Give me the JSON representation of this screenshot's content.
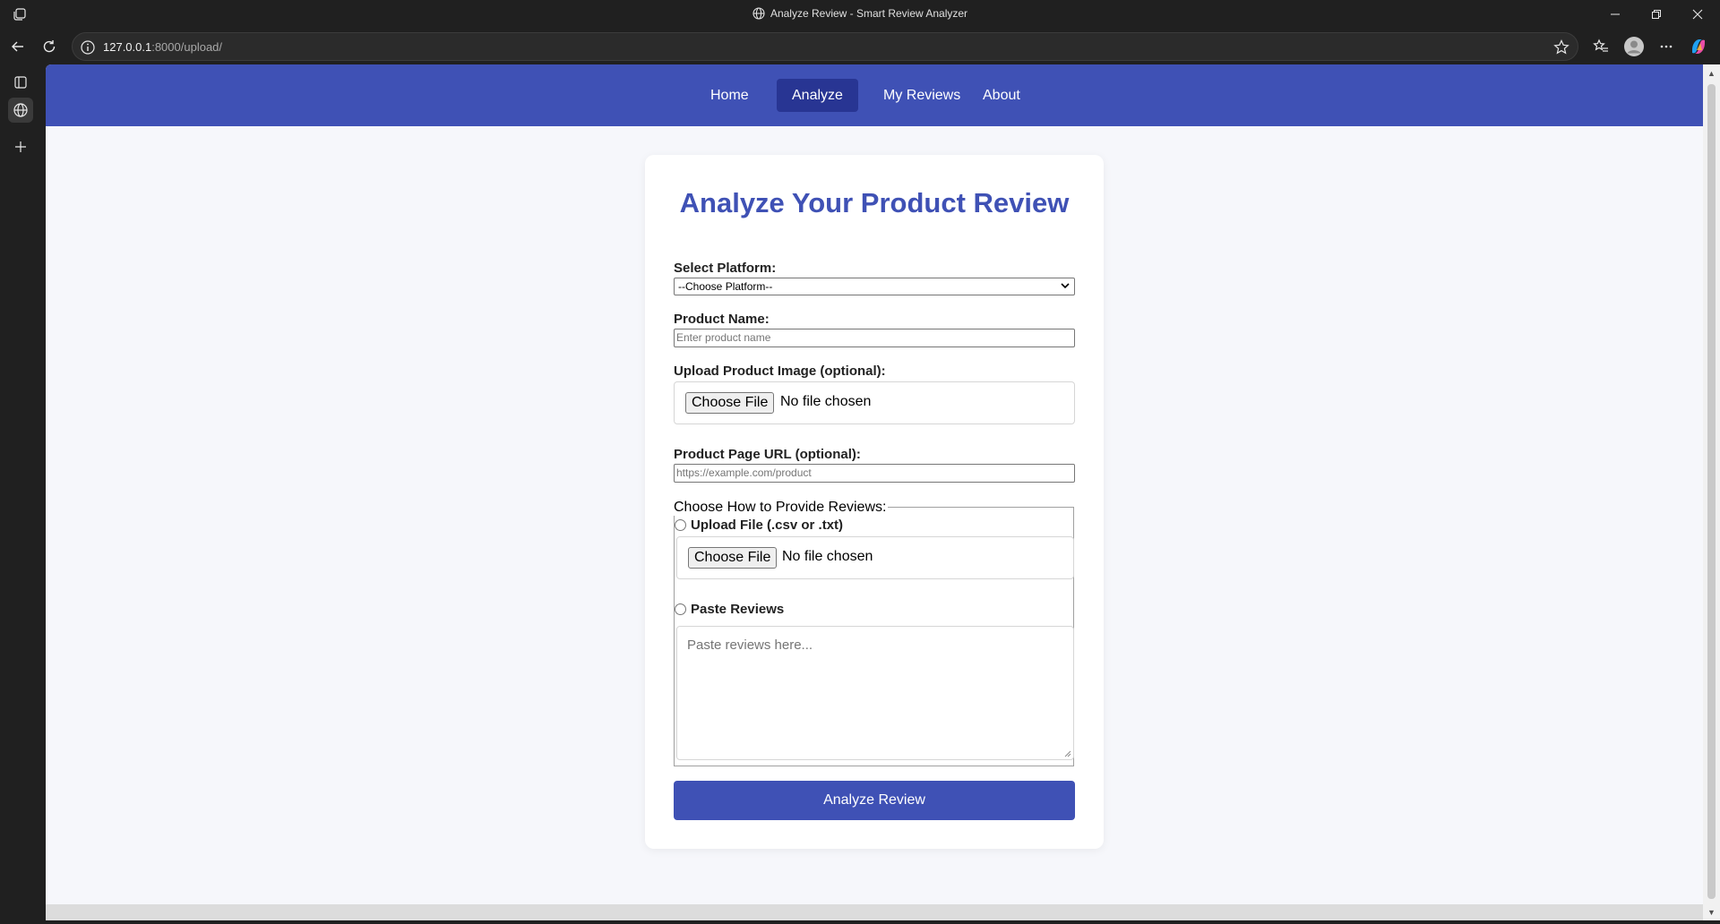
{
  "browser": {
    "tab_title": "Analyze Review - Smart Review Analyzer",
    "url_host": "127.0.0.1",
    "url_rest": ":8000/upload/"
  },
  "nav": {
    "items": [
      "Home",
      "Analyze",
      "My Reviews",
      "About"
    ],
    "active": "Analyze"
  },
  "form": {
    "title": "Analyze Your Product Review",
    "platform_label": "Select Platform:",
    "platform_selected": "--Choose Platform--",
    "product_name_label": "Product Name:",
    "product_name_placeholder": "Enter product name",
    "image_label": "Upload Product Image (optional):",
    "choose_file": "Choose File",
    "no_file": "No file chosen",
    "url_label": "Product Page URL (optional):",
    "url_placeholder": "https://example.com/product",
    "reviews_legend": "Choose How to Provide Reviews:",
    "option_upload": "Upload File (.csv or .txt)",
    "option_paste": "Paste Reviews",
    "paste_placeholder": "Paste reviews here...",
    "submit_label": "Analyze Review"
  },
  "colors": {
    "primary": "#3f51b5",
    "nav_active": "#283593",
    "page_bg": "#f6f7fb"
  }
}
